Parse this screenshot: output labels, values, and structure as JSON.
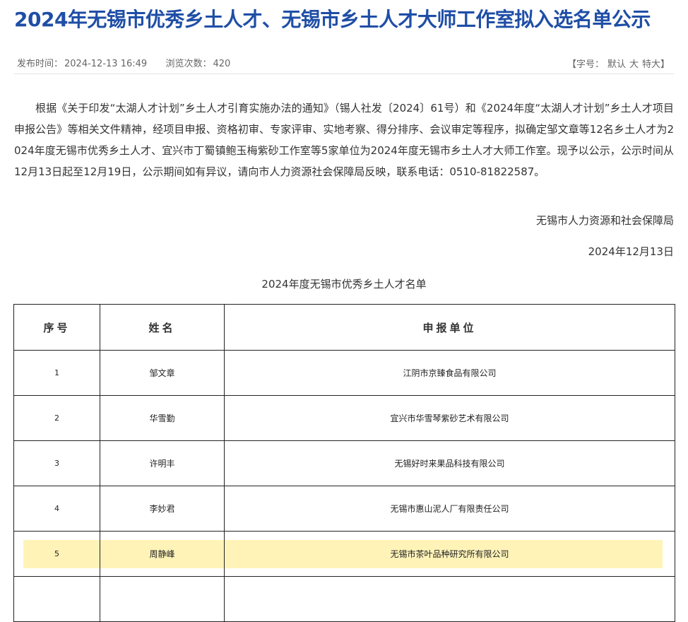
{
  "header": {
    "title": "2024年无锡市优秀乡土人才、无锡市乡土人才大师工作室拟入选名单公示"
  },
  "meta": {
    "publish_label": "发布时间：",
    "publish_time": "2024-12-13 16:49",
    "views_label": "浏览次数：",
    "views_count": "420",
    "font_size_label": "【字号：",
    "font_default": "默认",
    "font_large": "大",
    "font_xlarge": "特大】"
  },
  "article": {
    "paragraph": "根据《关于印发“太湖人才计划”乡土人才引育实施办法的通知》（锡人社发〔2024〕61号）和《2024年度“太湖人才计划”乡土人才项目申报公告》等相关文件精神，经项目申报、资格初审、专家评审、实地考察、得分排序、会议审定等程序，拟确定邹文章等12名乡土人才为2024年度无锡市优秀乡土人才、宜兴市丁蜀镇鲍玉梅紫砂工作室等5家单位为2024年度无锡市乡土人才大师工作室。现予以公示，公示时间从12月13日起至12月19日，公示期间如有异议，请向市人力资源社会保障局反映，联系电话：0510-81822587。",
    "signature": "无锡市人力资源和社会保障局",
    "date": "2024年12月13日"
  },
  "table": {
    "caption": "2024年度无锡市优秀乡土人才名单",
    "headers": [
      "序号",
      "姓名",
      "申报单位"
    ],
    "rows": [
      {
        "no": "1",
        "name": "邹文章",
        "unit": "江阴市京臻食品有限公司"
      },
      {
        "no": "2",
        "name": "华雪勤",
        "unit": "宜兴市华雪琴紫砂艺术有限公司"
      },
      {
        "no": "3",
        "name": "许明丰",
        "unit": "无锡好时来果品科技有限公司"
      },
      {
        "no": "4",
        "name": "李妙君",
        "unit": "无锡市惠山泥人厂有限责任公司"
      },
      {
        "no": "5",
        "name": "周静峰",
        "unit": "无锡市茶叶品种研究所有限公司"
      }
    ]
  },
  "colors": {
    "title": "#1f4ea6",
    "highlight": "#fff3b8"
  }
}
